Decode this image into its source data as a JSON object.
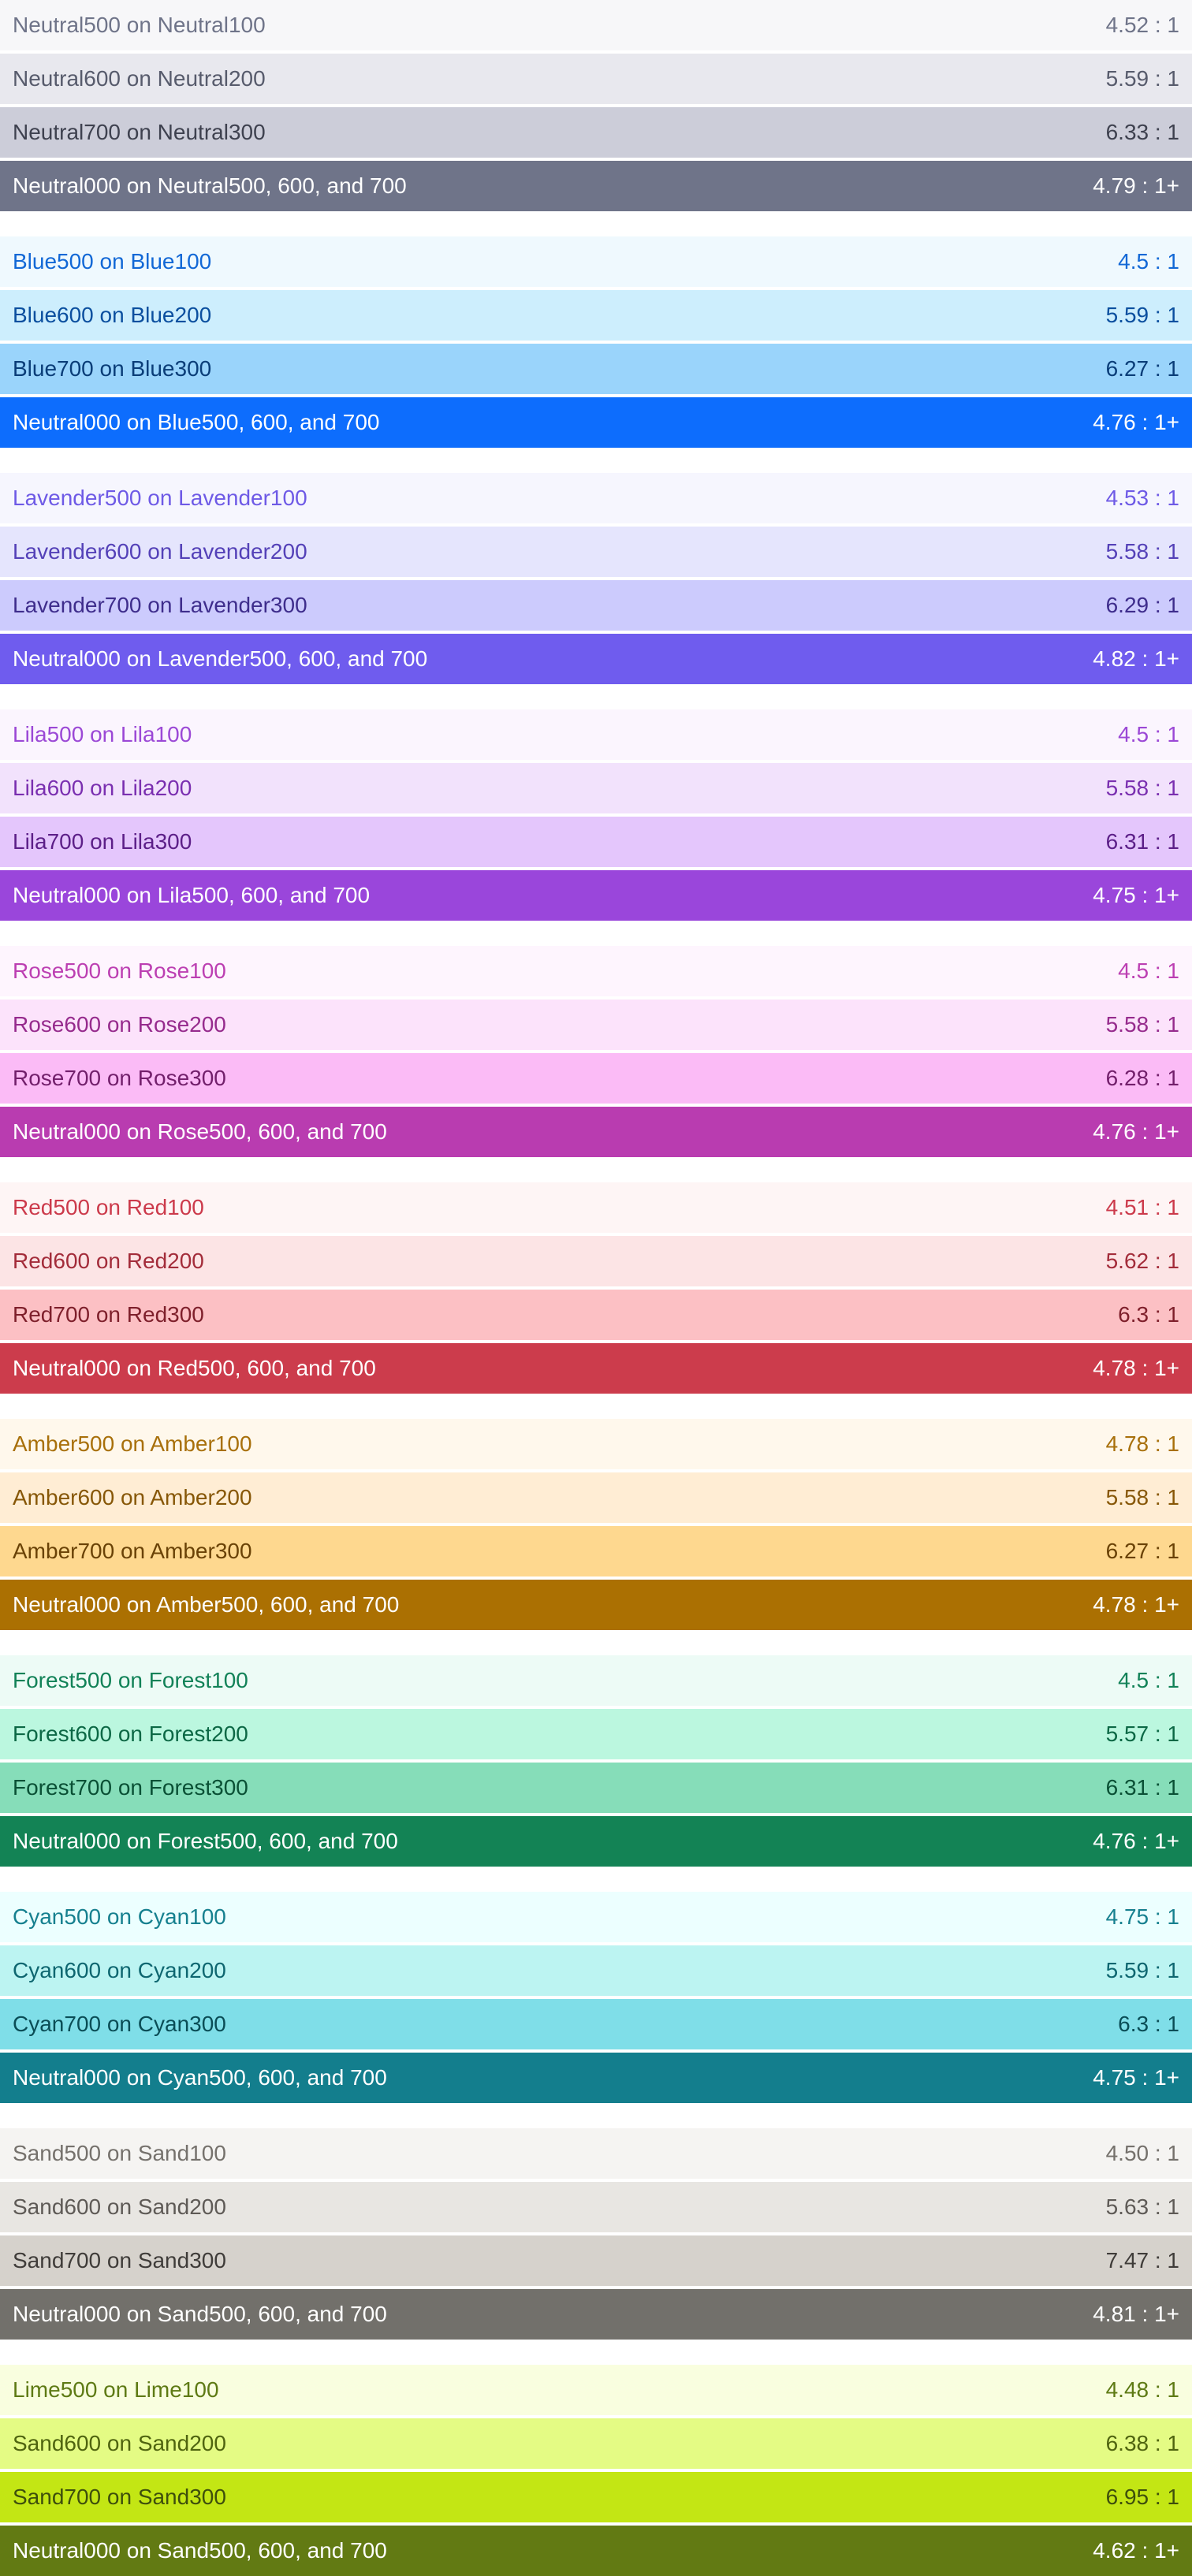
{
  "groups": [
    {
      "rows": [
        {
          "label": "Neutral500 on Neutral100",
          "ratio": "4.52 : 1",
          "bg": "#f7f7f9",
          "fg": "#6f7489"
        },
        {
          "label": "Neutral600 on Neutral200",
          "ratio": "5.59 : 1",
          "bg": "#e8e8ee",
          "fg": "#575b6c"
        },
        {
          "label": "Neutral700 on Neutral300",
          "ratio": "6.33 : 1",
          "bg": "#cccdd9",
          "fg": "#3e414f"
        },
        {
          "label": "Neutral000 on Neutral500, 600, and 700",
          "ratio": "4.79 : 1+",
          "bg": "#6f7489",
          "fg": "#ffffff"
        }
      ]
    },
    {
      "rows": [
        {
          "label": "Blue500 on Blue100",
          "ratio": "4.5 : 1",
          "bg": "#eff9fe",
          "fg": "#1268d6"
        },
        {
          "label": "Blue600 on Blue200",
          "ratio": "5.59 : 1",
          "bg": "#cdeefd",
          "fg": "#0b4f9f"
        },
        {
          "label": "Blue700 on Blue300",
          "ratio": "6.27 : 1",
          "bg": "#9ad4fb",
          "fg": "#0a3d78"
        },
        {
          "label": "Neutral000 on Blue500, 600, and 700",
          "ratio": "4.76 : 1+",
          "bg": "#0d6dfd",
          "fg": "#ffffff"
        }
      ]
    },
    {
      "rows": [
        {
          "label": "Lavender500 on Lavender100",
          "ratio": "4.53 : 1",
          "bg": "#f6f6fe",
          "fg": "#6e5ae6"
        },
        {
          "label": "Lavender600 on Lavender200",
          "ratio": "5.58 : 1",
          "bg": "#e5e5fd",
          "fg": "#5441b8"
        },
        {
          "label": "Lavender700 on Lavender300",
          "ratio": "6.29 : 1",
          "bg": "#cccbfd",
          "fg": "#3e2d8c"
        },
        {
          "label": "Neutral000 on Lavender500, 600, and 700",
          "ratio": "4.82 : 1+",
          "bg": "#6f5cee",
          "fg": "#ffffff"
        }
      ]
    },
    {
      "rows": [
        {
          "label": "Lila500 on Lila100",
          "ratio": "4.5 : 1",
          "bg": "#fbf5fe",
          "fg": "#9b48d6"
        },
        {
          "label": "Lila600 on Lila200",
          "ratio": "5.58 : 1",
          "bg": "#f2e2fc",
          "fg": "#7a2fb0"
        },
        {
          "label": "Lila700 on Lila300",
          "ratio": "6.31 : 1",
          "bg": "#e4c6fc",
          "fg": "#5c1f88"
        },
        {
          "label": "Neutral000 on Lila500, 600, and 700",
          "ratio": "4.75 : 1+",
          "bg": "#9a46db",
          "fg": "#ffffff"
        }
      ]
    },
    {
      "rows": [
        {
          "label": "Rose500 on Rose100",
          "ratio": "4.5 : 1",
          "bg": "#fef5fe",
          "fg": "#bc3fb2"
        },
        {
          "label": "Rose600 on Rose200",
          "ratio": "5.58 : 1",
          "bg": "#fce3fb",
          "fg": "#962b8d"
        },
        {
          "label": "Rose700 on Rose300",
          "ratio": "6.28 : 1",
          "bg": "#fbbbf6",
          "fg": "#721f6b"
        },
        {
          "label": "Neutral000 on Rose500, 600, and 700",
          "ratio": "4.76 : 1+",
          "bg": "#b93cb0",
          "fg": "#ffffff"
        }
      ]
    },
    {
      "rows": [
        {
          "label": "Red500 on Red100",
          "ratio": "4.51 : 1",
          "bg": "#fef5f5",
          "fg": "#cc3a4b"
        },
        {
          "label": "Red600 on Red200",
          "ratio": "5.62 : 1",
          "bg": "#fce4e5",
          "fg": "#a32c3a"
        },
        {
          "label": "Red700 on Red300",
          "ratio": "6.3 : 1",
          "bg": "#fcc0c4",
          "fg": "#7e1f2b"
        },
        {
          "label": "Neutral000 on Red500, 600, and 700",
          "ratio": "4.78 : 1+",
          "bg": "#cc3c4c",
          "fg": "#ffffff"
        }
      ]
    },
    {
      "rows": [
        {
          "label": "Amber500 on Amber100",
          "ratio": "4.78 : 1",
          "bg": "#fff8ec",
          "fg": "#a8700b"
        },
        {
          "label": "Amber600 on Amber200",
          "ratio": "5.58 : 1",
          "bg": "#ffedd4",
          "fg": "#875707"
        },
        {
          "label": "Amber700 on Amber300",
          "ratio": "6.27 : 1",
          "bg": "#fed88f",
          "fg": "#6a4206"
        },
        {
          "label": "Neutral000 on Amber500, 600, and 700",
          "ratio": "4.78 : 1+",
          "bg": "#ab7002",
          "fg": "#ffffff"
        }
      ]
    },
    {
      "rows": [
        {
          "label": "Forest500 on Forest100",
          "ratio": "4.5 : 1",
          "bg": "#edfbf6",
          "fg": "#128258"
        },
        {
          "label": "Forest600 on Forest200",
          "ratio": "5.57 : 1",
          "bg": "#bbf7df",
          "fg": "#0c6845"
        },
        {
          "label": "Forest700 on Forest300",
          "ratio": "6.31 : 1",
          "bg": "#86ddb9",
          "fg": "#0a5035"
        },
        {
          "label": "Neutral000 on Forest500, 600, and 700",
          "ratio": "4.76 : 1+",
          "bg": "#138355",
          "fg": "#ffffff"
        }
      ]
    },
    {
      "rows": [
        {
          "label": "Cyan500 on Cyan100",
          "ratio": "4.75 : 1",
          "bg": "#ecffff",
          "fg": "#16808f"
        },
        {
          "label": "Cyan600 on Cyan200",
          "ratio": "5.59 : 1",
          "bg": "#bcf4f2",
          "fg": "#0e6670"
        },
        {
          "label": "Cyan700 on Cyan300",
          "ratio": "6.3 : 1",
          "bg": "#7fdee8",
          "fg": "#0a4d56"
        },
        {
          "label": "Neutral000 on Cyan500, 600, and 700",
          "ratio": "4.75 : 1+",
          "bg": "#137e8d",
          "fg": "#ffffff"
        }
      ]
    },
    {
      "rows": [
        {
          "label": "Sand500 on Sand100",
          "ratio": "4.50 : 1",
          "bg": "#f5f4f2",
          "fg": "#75716c"
        },
        {
          "label": "Sand600 on Sand200",
          "ratio": "5.63 : 1",
          "bg": "#e8e6e2",
          "fg": "#5e5a56"
        },
        {
          "label": "Sand700 on Sand300",
          "ratio": "7.47 : 1",
          "bg": "#d6d2cc",
          "fg": "#3f3c39"
        },
        {
          "label": "Neutral000 on Sand500, 600, and 700",
          "ratio": "4.81 : 1+",
          "bg": "#72706b",
          "fg": "#ffffff"
        }
      ]
    },
    {
      "rows": [
        {
          "label": "Lime500 on Lime100",
          "ratio": "4.48 : 1",
          "bg": "#f9fedf",
          "fg": "#5e7a14"
        },
        {
          "label": "Sand600 on Sand200",
          "ratio": "6.38 : 1",
          "bg": "#e4fb84",
          "fg": "#4f640f"
        },
        {
          "label": "Sand700 on Sand300",
          "ratio": "6.95 : 1",
          "bg": "#c3e614",
          "fg": "#3e4f0c"
        },
        {
          "label": "Neutral000 on Sand500, 600, and 700",
          "ratio": "4.62 : 1+",
          "bg": "#627a13",
          "fg": "#ffffff"
        }
      ]
    }
  ]
}
